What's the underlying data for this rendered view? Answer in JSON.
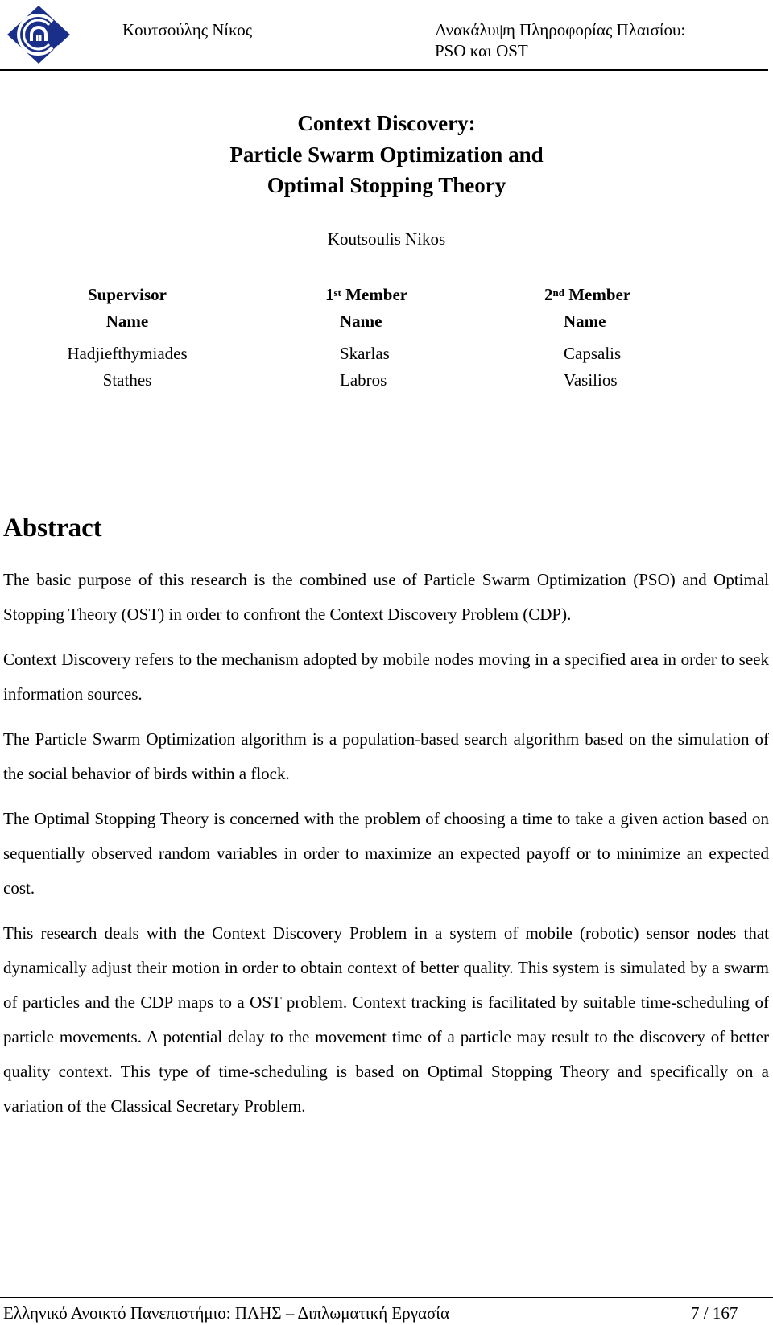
{
  "header": {
    "logo_icon": "university-logo-icon",
    "logo_color": "#1a2f8a",
    "author": "Κουτσούλης Νίκος",
    "title_line1": "Ανακάλυψη Πληροφορίας Πλαισίου:",
    "title_line2": "PSO και OST"
  },
  "title": {
    "lines": [
      "Context Discovery:",
      "Particle Swarm Optimization and",
      "Optimal Stopping Theory"
    ],
    "author": "Koutsoulis Nikos"
  },
  "committee": [
    {
      "role_prefix": "Supervisor",
      "role_sup": "",
      "role_suffix": "",
      "name_label": "Name",
      "surname": "Hadjiefthymiades",
      "given_name": "Stathes"
    },
    {
      "role_prefix": "1",
      "role_sup": "st",
      "role_suffix": " Member",
      "name_label": "Name",
      "surname": "Skarlas",
      "given_name": "Labros"
    },
    {
      "role_prefix": "2",
      "role_sup": "nd",
      "role_suffix": " Member",
      "name_label": "Name",
      "surname": "Capsalis",
      "given_name": "Vasilios"
    }
  ],
  "abstract": {
    "heading": "Abstract",
    "paragraphs": [
      "The basic purpose of this research is the combined use of Particle Swarm Optimization (PSO) and Optimal Stopping Theory (OST) in order to confront the Context Discovery Problem (CDP).",
      "Context Discovery refers to the mechanism adopted by mobile nodes moving in a specified area in order to seek information sources.",
      "The Particle Swarm Optimization algorithm is a population-based search algorithm based on the simulation of the social behavior of birds within a flock.",
      "The Optimal Stopping Theory is concerned with the problem of choosing a time to take a given action based on sequentially observed random variables in order to maximize an expected payoff or to minimize an expected cost.",
      "This research deals with the Context Discovery Problem in a system of mobile (robotic) sensor nodes that dynamically adjust their motion in order to obtain context of better quality. This system is simulated by a swarm of particles and the CDP maps to a OST problem. Context tracking is facilitated by suitable time-scheduling of particle movements.  A potential delay to the movement time of a particle may result to the discovery of better quality context. This type of time-scheduling is based on Optimal Stopping Theory and specifically on a variation of the Classical Secretary Problem."
    ]
  },
  "footer": {
    "text": "Ελληνικό Ανοικτό Πανεπιστήμιο: ΠΛΗΣ – Διπλωματική Εργασία",
    "page": "7 / 167"
  }
}
